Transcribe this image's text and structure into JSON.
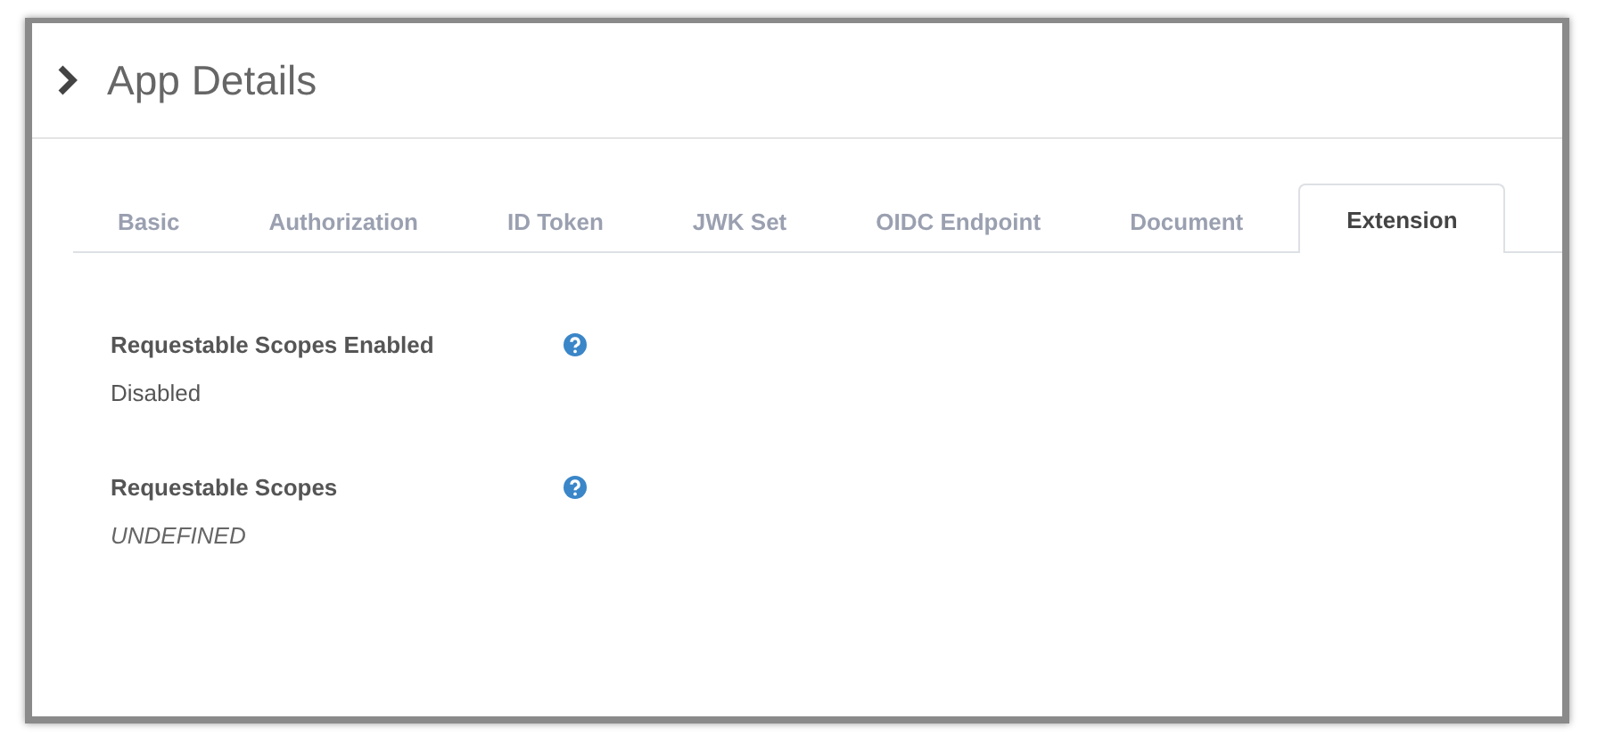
{
  "header": {
    "title": "App Details"
  },
  "tabs": [
    {
      "label": "Basic",
      "selected": false
    },
    {
      "label": "Authorization",
      "selected": false
    },
    {
      "label": "ID Token",
      "selected": false
    },
    {
      "label": "JWK Set",
      "selected": false
    },
    {
      "label": "OIDC Endpoint",
      "selected": false
    },
    {
      "label": "Document",
      "selected": false
    },
    {
      "label": "Extension",
      "selected": true
    }
  ],
  "fields": [
    {
      "label": "Requestable Scopes Enabled",
      "value": "Disabled",
      "kind": "set"
    },
    {
      "label": "Requestable Scopes",
      "value": "UNDEFINED",
      "kind": "unset"
    }
  ]
}
